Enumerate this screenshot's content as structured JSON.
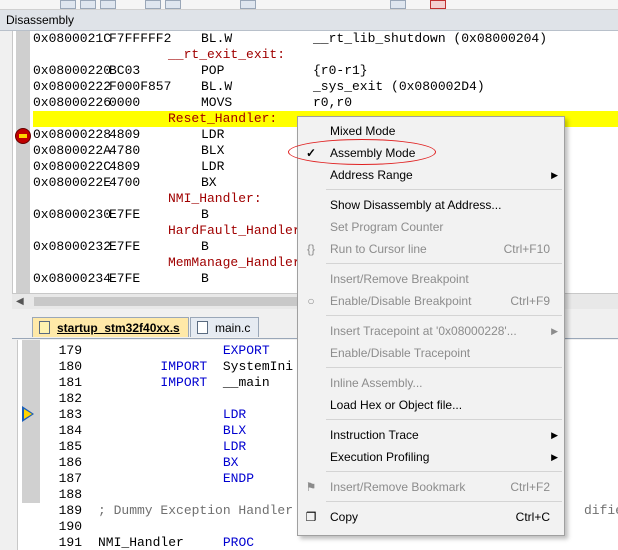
{
  "disassembly": {
    "title": "Disassembly",
    "lines": [
      {
        "kind": "code",
        "addr": "0x0800021C",
        "opcode": "F7FFFFF2",
        "mnemonic": "BL.W",
        "operand": "__rt_lib_shutdown (0x08000204)"
      },
      {
        "kind": "label",
        "text": "__rt_exit_exit:"
      },
      {
        "kind": "code",
        "addr": "0x08000220",
        "opcode": "BC03",
        "mnemonic": "POP",
        "operand": "{r0-r1}"
      },
      {
        "kind": "code",
        "addr": "0x08000222",
        "opcode": "F000F857",
        "mnemonic": "BL.W",
        "operand": "_sys_exit (0x080002D4)"
      },
      {
        "kind": "code",
        "addr": "0x08000226",
        "opcode": "0000",
        "mnemonic": "MOVS",
        "operand": "r0,r0"
      },
      {
        "kind": "label",
        "text": "Reset_Handler:",
        "highlight": true
      },
      {
        "kind": "code",
        "addr": "0x08000228",
        "opcode": "4809",
        "mnemonic": "LDR",
        "operand": ""
      },
      {
        "kind": "code",
        "addr": "0x0800022A",
        "opcode": "4780",
        "mnemonic": "BLX",
        "operand": ""
      },
      {
        "kind": "code",
        "addr": "0x0800022C",
        "opcode": "4809",
        "mnemonic": "LDR",
        "operand": ""
      },
      {
        "kind": "code",
        "addr": "0x0800022E",
        "opcode": "4700",
        "mnemonic": "BX",
        "operand": ""
      },
      {
        "kind": "label",
        "text": "NMI_Handler:"
      },
      {
        "kind": "code",
        "addr": "0x08000230",
        "opcode": "E7FE",
        "mnemonic": "B",
        "operand": ""
      },
      {
        "kind": "label",
        "text": "HardFault_Handler"
      },
      {
        "kind": "code",
        "addr": "0x08000232",
        "opcode": "E7FE",
        "mnemonic": "B",
        "operand": ""
      },
      {
        "kind": "label",
        "text": "MemManage_Handler"
      },
      {
        "kind": "code",
        "addr": "0x08000234",
        "opcode": "E7FE",
        "mnemonic": "B",
        "operand": ""
      }
    ]
  },
  "tabs": [
    {
      "label": "startup_stm32f40xx.s",
      "active": true
    },
    {
      "label": "main.c",
      "active": false
    }
  ],
  "editor": {
    "lines": [
      {
        "num": "179",
        "pre": "                ",
        "kw": "EXPORT",
        "rest": ""
      },
      {
        "num": "180",
        "pre": "        ",
        "kw": "IMPORT",
        "rest": "  SystemIni"
      },
      {
        "num": "181",
        "pre": "        ",
        "kw": "IMPORT",
        "rest": "  __main"
      },
      {
        "num": "182",
        "pre": "",
        "kw": "",
        "rest": ""
      },
      {
        "num": "183",
        "pre": "                ",
        "kw": "LDR",
        "rest": ""
      },
      {
        "num": "184",
        "pre": "                ",
        "kw": "BLX",
        "rest": ""
      },
      {
        "num": "185",
        "pre": "                ",
        "kw": "LDR",
        "rest": ""
      },
      {
        "num": "186",
        "pre": "                ",
        "kw": "BX",
        "rest": ""
      },
      {
        "num": "187",
        "pre": "                ",
        "kw": "ENDP",
        "rest": ""
      },
      {
        "num": "188",
        "pre": "",
        "kw": "",
        "rest": ""
      },
      {
        "num": "189",
        "comment": "; Dummy Exception Handler",
        "comment_tail": "dified)"
      },
      {
        "num": "190",
        "pre": "",
        "kw": "",
        "rest": ""
      },
      {
        "num": "191",
        "label": "NMI_Handler",
        "pre2": "     ",
        "kw": "PROC",
        "rest": ""
      }
    ]
  },
  "context_menu": {
    "items": [
      {
        "label": "Mixed Mode",
        "shortcut": "",
        "disabled": false
      },
      {
        "label": "Assembly Mode",
        "shortcut": "",
        "disabled": false,
        "checked": true
      },
      {
        "label": "Address Range",
        "shortcut": "",
        "disabled": false,
        "submenu": true
      },
      {
        "label": "Show Disassembly at Address...",
        "shortcut": "",
        "disabled": false
      },
      {
        "label": "Set Program Counter",
        "shortcut": "",
        "disabled": true
      },
      {
        "label": "Run to Cursor line",
        "shortcut": "Ctrl+F10",
        "disabled": true,
        "icon": "run-to-cursor-icon"
      },
      {
        "label": "Insert/Remove Breakpoint",
        "shortcut": "",
        "disabled": true
      },
      {
        "label": "Enable/Disable Breakpoint",
        "shortcut": "Ctrl+F9",
        "disabled": true,
        "icon": "breakpoint-circle-icon"
      },
      {
        "label": "Insert Tracepoint at '0x08000228'...",
        "shortcut": "",
        "disabled": true,
        "submenu": true
      },
      {
        "label": "Enable/Disable Tracepoint",
        "shortcut": "",
        "disabled": true
      },
      {
        "label": "Inline Assembly...",
        "shortcut": "",
        "disabled": true
      },
      {
        "label": "Load Hex or Object file...",
        "shortcut": "",
        "disabled": false
      },
      {
        "label": "Instruction Trace",
        "shortcut": "",
        "disabled": false,
        "submenu": true
      },
      {
        "label": "Execution Profiling",
        "shortcut": "",
        "disabled": false,
        "submenu": true
      },
      {
        "label": "Insert/Remove Bookmark",
        "shortcut": "Ctrl+F2",
        "disabled": true,
        "icon": "bookmark-flag-icon"
      },
      {
        "label": "Copy",
        "shortcut": "Ctrl+C",
        "disabled": false,
        "icon": "copy-icon"
      }
    ]
  },
  "colors": {
    "highlight_line": "#ffff00",
    "label_red": "#a00000",
    "keyword_blue": "#0000d0",
    "annotation_ellipse": "#e02020"
  }
}
